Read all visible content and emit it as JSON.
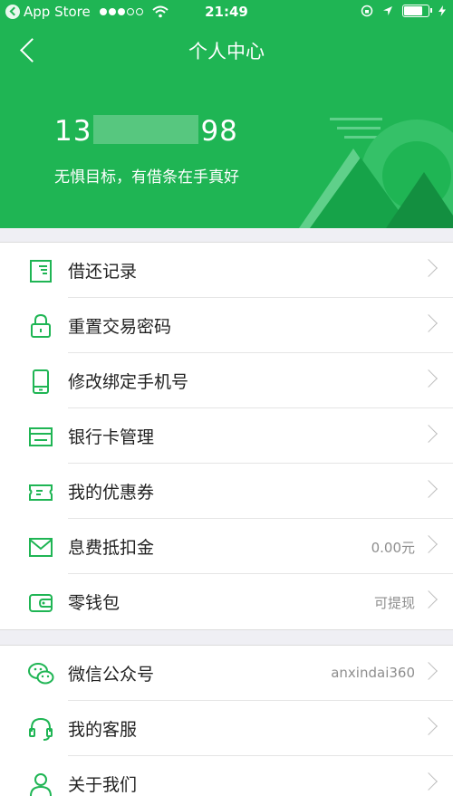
{
  "status_bar": {
    "carrier": "App Store",
    "time": "21:49",
    "battery_level": 0.7
  },
  "nav": {
    "title": "个人中心"
  },
  "profile": {
    "phone_prefix": "13",
    "phone_suffix": "98",
    "slogan": "无惧目标，有借条在手真好"
  },
  "menu_group_1": [
    {
      "label": "借还记录",
      "value": "",
      "icon": "ledger-icon"
    },
    {
      "label": "重置交易密码",
      "value": "",
      "icon": "lock-icon"
    },
    {
      "label": "修改绑定手机号",
      "value": "",
      "icon": "phone-icon"
    },
    {
      "label": "银行卡管理",
      "value": "",
      "icon": "bank-card-icon"
    },
    {
      "label": "我的优惠券",
      "value": "",
      "icon": "coupon-icon"
    },
    {
      "label": "息费抵扣金",
      "value": "0.00元",
      "icon": "envelope-icon"
    },
    {
      "label": "零钱包",
      "value": "可提现",
      "icon": "wallet-icon"
    }
  ],
  "menu_group_2": [
    {
      "label": "微信公众号",
      "value": "anxindai360",
      "icon": "wechat-icon"
    },
    {
      "label": "我的客服",
      "value": "",
      "icon": "headset-icon"
    },
    {
      "label": "关于我们",
      "value": "",
      "icon": "person-icon"
    }
  ],
  "colors": {
    "brand_green": "#1fb554",
    "icon_green": "#1fb554"
  }
}
